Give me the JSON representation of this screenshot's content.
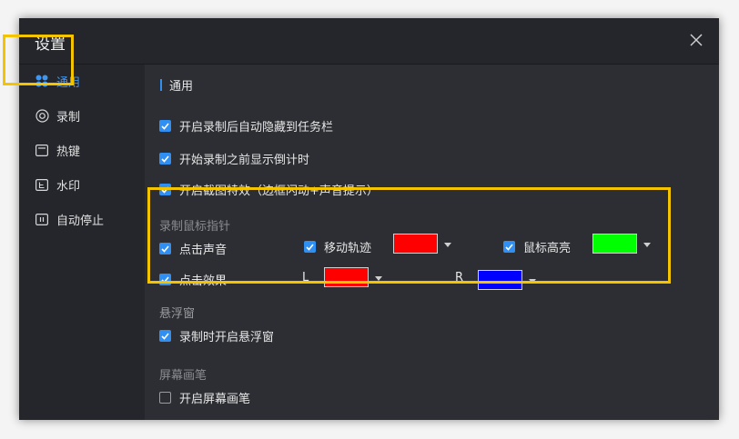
{
  "dialog": {
    "title": "设置"
  },
  "sidebar": {
    "items": [
      {
        "label": "通用",
        "icon": "grid-dots-icon",
        "active": true
      },
      {
        "label": "录制",
        "icon": "record-circle-icon",
        "active": false
      },
      {
        "label": "热键",
        "icon": "keyboard-box-icon",
        "active": false
      },
      {
        "label": "水印",
        "icon": "watermark-icon",
        "active": false
      },
      {
        "label": "自动停止",
        "icon": "pause-box-icon",
        "active": false
      }
    ]
  },
  "general": {
    "section_title": "通用",
    "options": [
      {
        "label": "开启录制后自动隐藏到任务栏",
        "checked": true
      },
      {
        "label": "开始录制之前显示倒计时",
        "checked": true
      },
      {
        "label": "开启截图特效（边框闪动+声音提示）",
        "checked": true
      }
    ]
  },
  "cursor_group": {
    "title": "录制鼠标指针",
    "click_sound": {
      "label": "点击声音",
      "checked": true
    },
    "move_track": {
      "label": "移动轨迹",
      "checked": true,
      "color": "#ff0000"
    },
    "highlight": {
      "label": "鼠标高亮",
      "checked": true,
      "color": "#00ff00"
    },
    "click_effect": {
      "label": "点击效果",
      "checked": true
    },
    "left": {
      "label": "L",
      "color": "#ff0000"
    },
    "right": {
      "label": "R",
      "color": "#0000ff"
    }
  },
  "float_window": {
    "title": "悬浮窗",
    "option": {
      "label": "录制时开启悬浮窗",
      "checked": true
    }
  },
  "screen_pen": {
    "title": "屏幕画笔",
    "option": {
      "label": "开启屏幕画笔",
      "checked": false
    }
  },
  "colors": {
    "accent": "#2f8ff2",
    "highlight_box": "#f5c400"
  }
}
